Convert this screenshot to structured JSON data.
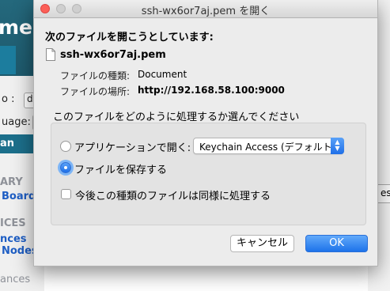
{
  "background": {
    "site_title": "me",
    "field_label_1": "o :",
    "field_value_1": "de",
    "field_label_2": "uage:",
    "active_bar": "an",
    "section_1": "ARY",
    "link_1": "Board",
    "section_2": "ICES",
    "link_2a": "nces",
    "link_2b": "Nodes",
    "section_3": "ances",
    "right_button": "es"
  },
  "dialog": {
    "window_title": "ssh-wx6or7aj.pem を開く",
    "heading": "次のファイルを開こうとしています:",
    "file_name": "ssh-wx6or7aj.pem",
    "file_type_label": "ファイルの種類:",
    "file_type_value": "Document",
    "file_source_label": "ファイルの場所:",
    "file_source_value": "http://192.168.58.100:9000",
    "question": "このファイルをどのように処理するか選んでください",
    "option_open_label": "アプリケーションで開く:",
    "option_open_app": "Keychain Access (デフォルト)",
    "option_save_label": "ファイルを保存する",
    "remember_label": "今後この種類のファイルは同様に処理する",
    "cancel_label": "キャンセル",
    "ok_label": "OK",
    "selected_option": "save",
    "remember_checked": false
  },
  "colors": {
    "accent": "#1f6fe8",
    "header_bg": "#24687c",
    "close_button": "#fc5f57"
  },
  "icons": {
    "file": "document-icon",
    "popup": "up-down-chevron-icon"
  }
}
